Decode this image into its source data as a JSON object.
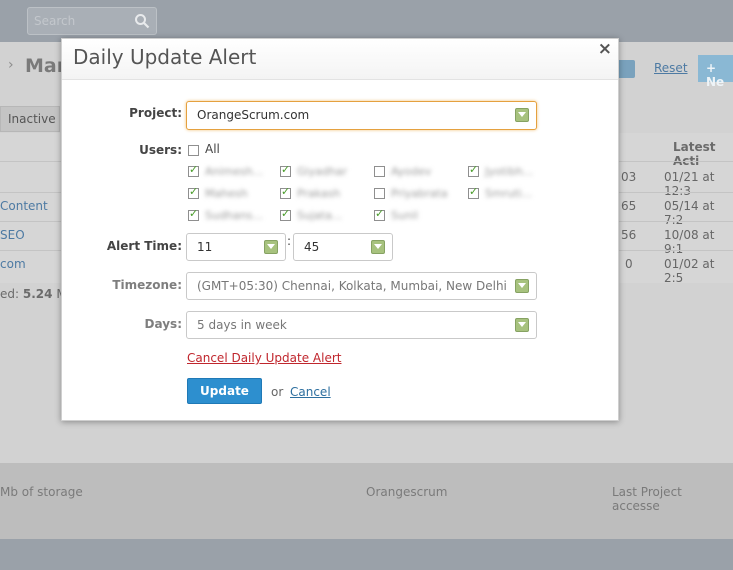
{
  "background": {
    "search_placeholder": "Search",
    "breadcrumb_arrow": "›",
    "page_title": "Man",
    "inactive_tab": "Inactive",
    "reset_link": "Reset",
    "new_button": "+ Ne",
    "latest_activity_header": "Latest Acti",
    "rows": [
      {
        "link": "",
        "num": "03",
        "date": "01/21 at 12:3"
      },
      {
        "link": "Content",
        "num": "65",
        "date": "05/14 at 7:2"
      },
      {
        "link": "SEO",
        "num": "56",
        "date": "10/08 at 9:1"
      },
      {
        "link": "com",
        "num": "0",
        "date": "01/02 at 2:5"
      }
    ],
    "used_prefix": "ed:",
    "used_value": "5.24",
    "used_suffix": "M",
    "footer_storage": "Mb of storage",
    "footer_center": "Orangescrum",
    "footer_right": "Last Project accesse"
  },
  "modal": {
    "title": "Daily Update Alert",
    "close_glyph": "×",
    "project_label": "Project:",
    "project_value": "OrangeScrum.com",
    "users_label": "Users:",
    "all_label": "All",
    "users": [
      {
        "name": "Animesh...",
        "checked": true
      },
      {
        "name": "Giyadhar",
        "checked": true
      },
      {
        "name": "Ayodev",
        "checked": false
      },
      {
        "name": "Jyotibh...",
        "checked": true
      },
      {
        "name": "Mahesh",
        "checked": true
      },
      {
        "name": "Prakash",
        "checked": true
      },
      {
        "name": "Priyabrata",
        "checked": false
      },
      {
        "name": "Smruti...",
        "checked": true
      },
      {
        "name": "Sudhans...",
        "checked": true
      },
      {
        "name": "Sujata...",
        "checked": true
      },
      {
        "name": "Sunil",
        "checked": true
      }
    ],
    "alert_time_label": "Alert Time:",
    "hour_value": "11",
    "time_separator": ":",
    "minute_value": "45",
    "timezone_label": "Timezone:",
    "timezone_value": "(GMT+05:30) Chennai, Kolkata, Mumbai, New Delhi",
    "days_label": "Days:",
    "days_value": "5 days in week",
    "cancel_alert_link": "Cancel Daily Update Alert",
    "update_button": "Update",
    "or_text": "or",
    "cancel_link": "Cancel"
  },
  "colors": {
    "accent_blue": "#2d8fcf",
    "danger_red": "#c0262d",
    "focus_orange": "#e5a13f",
    "check_green": "#4a9d2b"
  }
}
